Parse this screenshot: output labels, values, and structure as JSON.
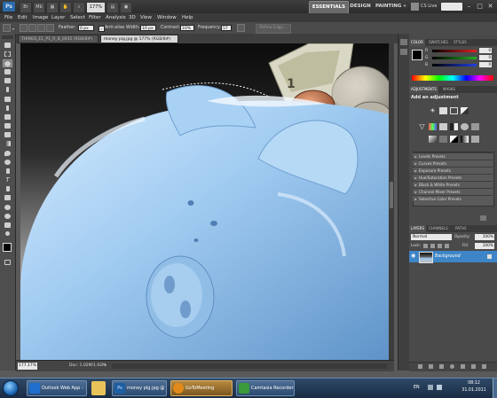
{
  "app": {
    "logo": "Ps",
    "zoom": "177%"
  },
  "workspaces": [
    "ESSENTIALS",
    "DESIGN",
    "PAINTING",
    "»"
  ],
  "cs_live": "CS Live",
  "menu": [
    "File",
    "Edit",
    "Image",
    "Layer",
    "Select",
    "Filter",
    "Analysis",
    "3D",
    "View",
    "Window",
    "Help"
  ],
  "options": {
    "feather_label": "Feather:",
    "feather_value": "0 px",
    "antialias_label": "Anti-alias",
    "width_label": "Width:",
    "width_value": "10 px",
    "contrast_label": "Contrast:",
    "contrast_value": "10%",
    "frequency_label": "Frequency:",
    "frequency_value": "57",
    "refine_edge": "Refine Edge..."
  },
  "document": {
    "tabs": [
      {
        "label": "THINGS_E1_P1_R_B_0035 (RGB/8#)",
        "active": false
      },
      {
        "label": "money pig.jpg @ 177% (RGB/8#)",
        "active": true
      }
    ],
    "tab_close": "×",
    "status_zoom": "177.17%",
    "status_doc": "Doc: 1.02M/1.02M"
  },
  "panels": {
    "color_tabs": [
      "COLOR",
      "SWATCHES",
      "STYLES"
    ],
    "color": {
      "channels": [
        {
          "label": "R",
          "value": "0",
          "track": "#e02020"
        },
        {
          "label": "G",
          "value": "0",
          "track": "#20b020"
        },
        {
          "label": "B",
          "value": "0",
          "track": "#2040e0"
        }
      ]
    },
    "adjust_tabs": [
      "ADJUSTMENTS",
      "MASKS"
    ],
    "adjust_title": "Add an adjustment",
    "presets": [
      "Levels Presets",
      "Curves Presets",
      "Exposure Presets",
      "Hue/Saturation Presets",
      "Black & White Presets",
      "Channel Mixer Presets",
      "Selective Color Presets"
    ],
    "layers_tabs": [
      "LAYERS",
      "CHANNELS",
      "PATHS"
    ],
    "blend_mode": "Normal",
    "opacity_label": "Opacity:",
    "opacity_value": "100%",
    "lock_label": "Lock:",
    "fill_label": "Fill:",
    "fill_value": "100%",
    "layer_name": "Background"
  },
  "taskbar": {
    "tasks": [
      {
        "label": "Outlook Web App -",
        "active": false,
        "color": "#1e6fcf"
      },
      {
        "label": "money pig.jpg @",
        "active": false,
        "color": "#1d5fa3"
      },
      {
        "label": "GoToMeeting",
        "active": true,
        "color": "#e08a1a"
      },
      {
        "label": "Camtasia Recorder",
        "active": false,
        "color": "#3a9a3a"
      }
    ],
    "lang": "EN",
    "time": "08:12",
    "date": "31.01.2011"
  },
  "colors": {
    "selection_blue": "#3d85c6",
    "pig_blue": "#9ec9ee"
  }
}
